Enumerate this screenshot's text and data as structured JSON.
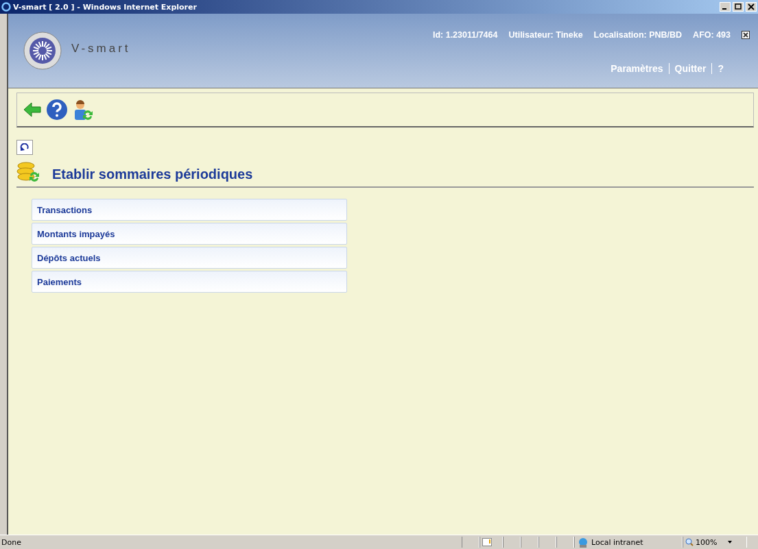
{
  "window": {
    "title": "V-smart [ 2.0 ] - Windows Internet Explorer"
  },
  "header": {
    "logo_text": "V-smart",
    "info": [
      "Id: 1.23011/7464",
      "Utilisateur: Tineke",
      "Localisation: PNB/BD",
      "AFO: 493"
    ],
    "links": [
      "Paramètres",
      "Quitter",
      "?"
    ]
  },
  "page": {
    "title": "Etablir sommaires périodiques"
  },
  "menu": [
    "Transactions",
    "Montants impayés",
    "Dépôts actuels",
    "Paiements"
  ],
  "status_bar": {
    "text": "Done",
    "zone": "Local intranet",
    "zoom": "100%"
  }
}
